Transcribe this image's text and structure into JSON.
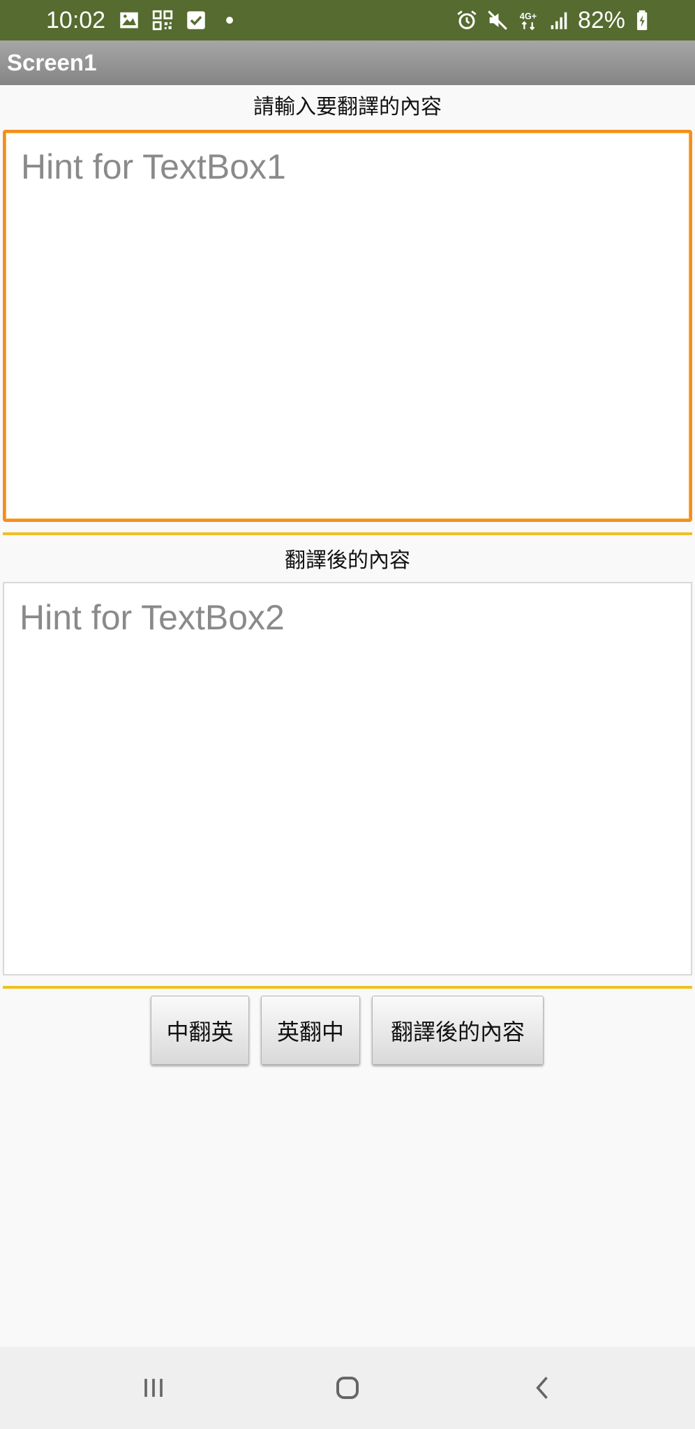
{
  "status_bar": {
    "time": "10:02",
    "battery": "82%",
    "left_icons": [
      "image-icon",
      "qr-code-icon",
      "checkbox-icon",
      "dot-icon"
    ],
    "right_icons": [
      "alarm-icon",
      "mute-icon",
      "4g-icon",
      "signal-icon",
      "battery-charging-icon"
    ],
    "network_label": "4G+",
    "color": "#556b2f"
  },
  "app_bar": {
    "title": "Screen1"
  },
  "main": {
    "input_label": "請輸入要翻譯的內容",
    "input_placeholder": "Hint for TextBox1",
    "input_value": "",
    "output_label": "翻譯後的內容",
    "output_placeholder": "Hint for TextBox2",
    "output_value": "",
    "focus_color": "#f28f1f",
    "divider_color": "#f0c020"
  },
  "buttons": {
    "zh_to_en": "中翻英",
    "en_to_zh": "英翻中",
    "translated_content": "翻譯後的內容"
  },
  "nav_bar": {
    "items": [
      "recents-icon",
      "home-icon",
      "back-icon"
    ]
  }
}
